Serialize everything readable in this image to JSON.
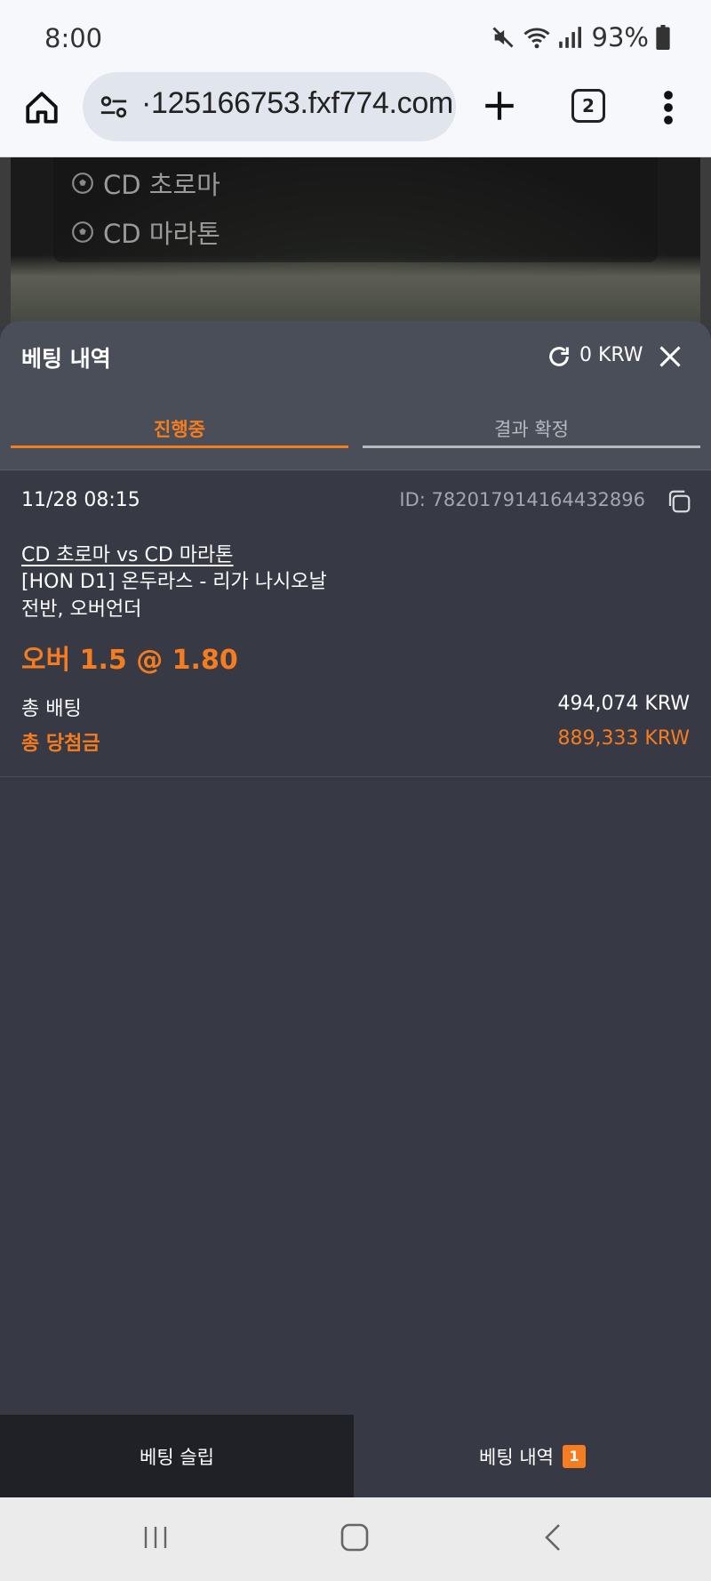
{
  "status_bar": {
    "time": "8:00",
    "battery": "93%"
  },
  "browser": {
    "url": "·125166753.fxf774.com",
    "tab_count": "2"
  },
  "background_page": {
    "teams": [
      "CD 초로마",
      "CD 마라톤"
    ]
  },
  "sheet": {
    "title": "베팅 내역",
    "balance": "0 KRW",
    "tabs": [
      {
        "label": "진행중",
        "active": true
      },
      {
        "label": "결과 확정",
        "active": false
      }
    ]
  },
  "bet": {
    "date": "11/28 08:15",
    "id": "ID: 782017914164432896",
    "match": "CD 초로마 vs CD 마라톤",
    "league": "[HON D1] 온두라스 - 리가 나시오날",
    "market": "전반, 오버언더",
    "pick": "오버 1.5 @ 1.80",
    "stake_label": "총 배팅",
    "stake_value": "494,074 KRW",
    "win_label": "총 당첨금",
    "win_value": "889,333 KRW"
  },
  "bottom_tabs": {
    "slip_label": "베팅 슬립",
    "history_label": "베팅 내역",
    "history_count": "1"
  },
  "colors": {
    "accent": "#f57c1f",
    "panel": "#373a45",
    "header": "#4a4e59"
  }
}
